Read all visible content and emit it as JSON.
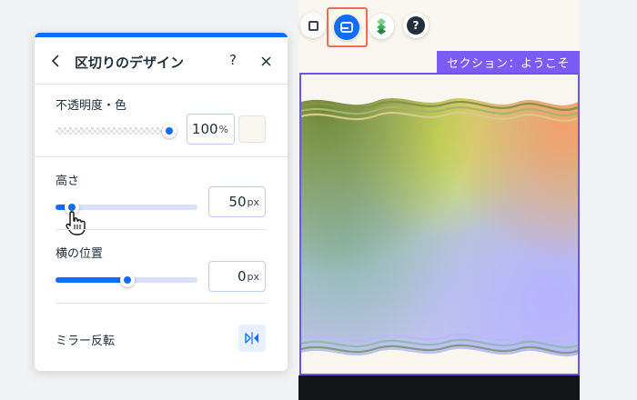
{
  "panel": {
    "title": "区切りのデザイン",
    "help_label": "?",
    "opacity_color": {
      "label": "不透明度・色",
      "value": "100",
      "unit": "%",
      "slider_level": 1.0,
      "swatch_color": "#f8f6ee"
    },
    "height": {
      "label": "高さ",
      "value": "50",
      "unit": "px",
      "slider_level": 0.1
    },
    "horizontal_position": {
      "label": "横の位置",
      "value": "0",
      "unit": "px",
      "slider_level": 0.5
    },
    "mirror": {
      "label": "ミラー反転"
    }
  },
  "canvas": {
    "section_tag": "セクション：ようこそ",
    "toolbar_icons": [
      "square-icon",
      "divider-icon",
      "layers-icon",
      "help-icon"
    ],
    "help_icon_label": "?"
  },
  "colors": {
    "accent": "#116dff",
    "section_frame": "#6a55e8",
    "section_tag_bg": "#7a5cf5",
    "highlight": "#f26b4f",
    "canvas_bg": "#f8f6ee"
  }
}
